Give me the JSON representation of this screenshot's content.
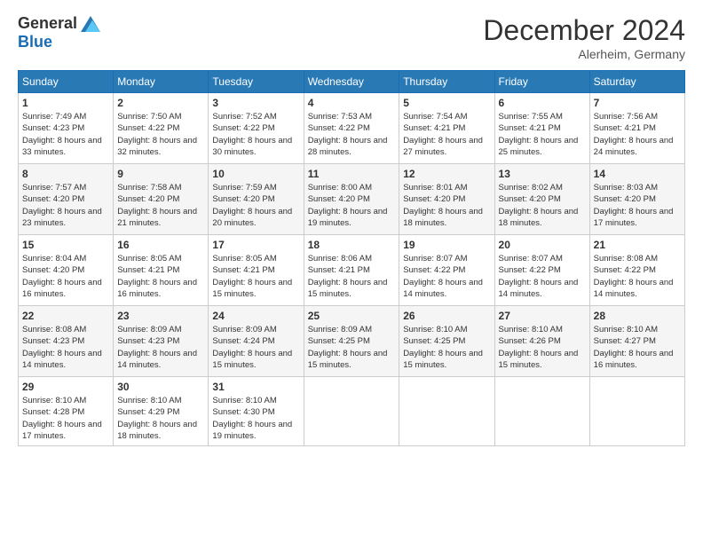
{
  "header": {
    "logo_general": "General",
    "logo_blue": "Blue",
    "month_title": "December 2024",
    "subtitle": "Alerheim, Germany"
  },
  "weekdays": [
    "Sunday",
    "Monday",
    "Tuesday",
    "Wednesday",
    "Thursday",
    "Friday",
    "Saturday"
  ],
  "weeks": [
    [
      {
        "day": "1",
        "sunrise": "Sunrise: 7:49 AM",
        "sunset": "Sunset: 4:23 PM",
        "daylight": "Daylight: 8 hours and 33 minutes."
      },
      {
        "day": "2",
        "sunrise": "Sunrise: 7:50 AM",
        "sunset": "Sunset: 4:22 PM",
        "daylight": "Daylight: 8 hours and 32 minutes."
      },
      {
        "day": "3",
        "sunrise": "Sunrise: 7:52 AM",
        "sunset": "Sunset: 4:22 PM",
        "daylight": "Daylight: 8 hours and 30 minutes."
      },
      {
        "day": "4",
        "sunrise": "Sunrise: 7:53 AM",
        "sunset": "Sunset: 4:22 PM",
        "daylight": "Daylight: 8 hours and 28 minutes."
      },
      {
        "day": "5",
        "sunrise": "Sunrise: 7:54 AM",
        "sunset": "Sunset: 4:21 PM",
        "daylight": "Daylight: 8 hours and 27 minutes."
      },
      {
        "day": "6",
        "sunrise": "Sunrise: 7:55 AM",
        "sunset": "Sunset: 4:21 PM",
        "daylight": "Daylight: 8 hours and 25 minutes."
      },
      {
        "day": "7",
        "sunrise": "Sunrise: 7:56 AM",
        "sunset": "Sunset: 4:21 PM",
        "daylight": "Daylight: 8 hours and 24 minutes."
      }
    ],
    [
      {
        "day": "8",
        "sunrise": "Sunrise: 7:57 AM",
        "sunset": "Sunset: 4:20 PM",
        "daylight": "Daylight: 8 hours and 23 minutes."
      },
      {
        "day": "9",
        "sunrise": "Sunrise: 7:58 AM",
        "sunset": "Sunset: 4:20 PM",
        "daylight": "Daylight: 8 hours and 21 minutes."
      },
      {
        "day": "10",
        "sunrise": "Sunrise: 7:59 AM",
        "sunset": "Sunset: 4:20 PM",
        "daylight": "Daylight: 8 hours and 20 minutes."
      },
      {
        "day": "11",
        "sunrise": "Sunrise: 8:00 AM",
        "sunset": "Sunset: 4:20 PM",
        "daylight": "Daylight: 8 hours and 19 minutes."
      },
      {
        "day": "12",
        "sunrise": "Sunrise: 8:01 AM",
        "sunset": "Sunset: 4:20 PM",
        "daylight": "Daylight: 8 hours and 18 minutes."
      },
      {
        "day": "13",
        "sunrise": "Sunrise: 8:02 AM",
        "sunset": "Sunset: 4:20 PM",
        "daylight": "Daylight: 8 hours and 18 minutes."
      },
      {
        "day": "14",
        "sunrise": "Sunrise: 8:03 AM",
        "sunset": "Sunset: 4:20 PM",
        "daylight": "Daylight: 8 hours and 17 minutes."
      }
    ],
    [
      {
        "day": "15",
        "sunrise": "Sunrise: 8:04 AM",
        "sunset": "Sunset: 4:20 PM",
        "daylight": "Daylight: 8 hours and 16 minutes."
      },
      {
        "day": "16",
        "sunrise": "Sunrise: 8:05 AM",
        "sunset": "Sunset: 4:21 PM",
        "daylight": "Daylight: 8 hours and 16 minutes."
      },
      {
        "day": "17",
        "sunrise": "Sunrise: 8:05 AM",
        "sunset": "Sunset: 4:21 PM",
        "daylight": "Daylight: 8 hours and 15 minutes."
      },
      {
        "day": "18",
        "sunrise": "Sunrise: 8:06 AM",
        "sunset": "Sunset: 4:21 PM",
        "daylight": "Daylight: 8 hours and 15 minutes."
      },
      {
        "day": "19",
        "sunrise": "Sunrise: 8:07 AM",
        "sunset": "Sunset: 4:22 PM",
        "daylight": "Daylight: 8 hours and 14 minutes."
      },
      {
        "day": "20",
        "sunrise": "Sunrise: 8:07 AM",
        "sunset": "Sunset: 4:22 PM",
        "daylight": "Daylight: 8 hours and 14 minutes."
      },
      {
        "day": "21",
        "sunrise": "Sunrise: 8:08 AM",
        "sunset": "Sunset: 4:22 PM",
        "daylight": "Daylight: 8 hours and 14 minutes."
      }
    ],
    [
      {
        "day": "22",
        "sunrise": "Sunrise: 8:08 AM",
        "sunset": "Sunset: 4:23 PM",
        "daylight": "Daylight: 8 hours and 14 minutes."
      },
      {
        "day": "23",
        "sunrise": "Sunrise: 8:09 AM",
        "sunset": "Sunset: 4:23 PM",
        "daylight": "Daylight: 8 hours and 14 minutes."
      },
      {
        "day": "24",
        "sunrise": "Sunrise: 8:09 AM",
        "sunset": "Sunset: 4:24 PM",
        "daylight": "Daylight: 8 hours and 15 minutes."
      },
      {
        "day": "25",
        "sunrise": "Sunrise: 8:09 AM",
        "sunset": "Sunset: 4:25 PM",
        "daylight": "Daylight: 8 hours and 15 minutes."
      },
      {
        "day": "26",
        "sunrise": "Sunrise: 8:10 AM",
        "sunset": "Sunset: 4:25 PM",
        "daylight": "Daylight: 8 hours and 15 minutes."
      },
      {
        "day": "27",
        "sunrise": "Sunrise: 8:10 AM",
        "sunset": "Sunset: 4:26 PM",
        "daylight": "Daylight: 8 hours and 15 minutes."
      },
      {
        "day": "28",
        "sunrise": "Sunrise: 8:10 AM",
        "sunset": "Sunset: 4:27 PM",
        "daylight": "Daylight: 8 hours and 16 minutes."
      }
    ],
    [
      {
        "day": "29",
        "sunrise": "Sunrise: 8:10 AM",
        "sunset": "Sunset: 4:28 PM",
        "daylight": "Daylight: 8 hours and 17 minutes."
      },
      {
        "day": "30",
        "sunrise": "Sunrise: 8:10 AM",
        "sunset": "Sunset: 4:29 PM",
        "daylight": "Daylight: 8 hours and 18 minutes."
      },
      {
        "day": "31",
        "sunrise": "Sunrise: 8:10 AM",
        "sunset": "Sunset: 4:30 PM",
        "daylight": "Daylight: 8 hours and 19 minutes."
      },
      null,
      null,
      null,
      null
    ]
  ]
}
